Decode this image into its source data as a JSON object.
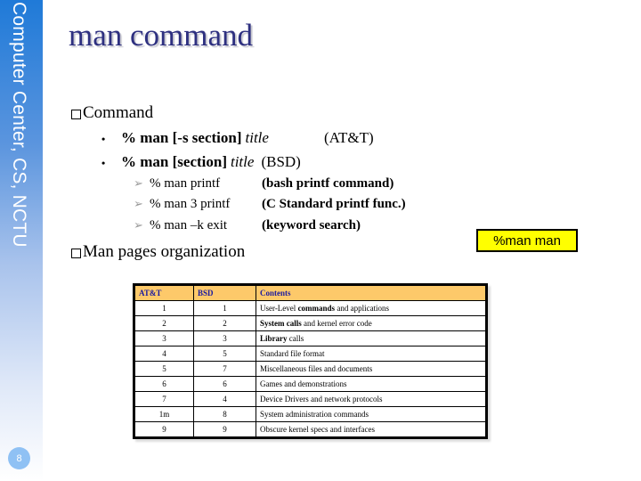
{
  "sidebar": {
    "title": "Computer Center, CS, NCTU",
    "page_number": "8"
  },
  "slide": {
    "title": "man command",
    "section1": {
      "heading": "Command",
      "bullets": [
        {
          "prefix": "% man [-s section]",
          "italic": "title",
          "note": "(AT&T)"
        },
        {
          "prefix": "% man [section]",
          "italic": "title",
          "note": "(BSD)"
        }
      ],
      "examples": [
        {
          "command": "% man printf",
          "note": "(bash printf command)"
        },
        {
          "command": "% man 3 printf",
          "note": "(C Standard printf func.)"
        },
        {
          "command": "% man –k exit",
          "note": "(keyword search)"
        }
      ]
    },
    "section2": {
      "heading": "Man pages organization"
    },
    "callout": "%man man",
    "table": {
      "headers": [
        "AT&T",
        "BSD",
        "Contents"
      ],
      "rows": [
        {
          "att": "1",
          "bsd": "1",
          "pre": "User-Level ",
          "bold": "commands",
          "post": " and applications"
        },
        {
          "att": "2",
          "bsd": "2",
          "pre": "",
          "bold": "System calls",
          "post": " and kernel error code"
        },
        {
          "att": "3",
          "bsd": "3",
          "pre": "",
          "bold": "Library",
          "post": " calls"
        },
        {
          "att": "4",
          "bsd": "5",
          "pre": "Standard file format",
          "bold": "",
          "post": ""
        },
        {
          "att": "5",
          "bsd": "7",
          "pre": "Miscellaneous files and documents",
          "bold": "",
          "post": ""
        },
        {
          "att": "6",
          "bsd": "6",
          "pre": "Games and demonstrations",
          "bold": "",
          "post": ""
        },
        {
          "att": "7",
          "bsd": "4",
          "pre": "Device Drivers and network protocols",
          "bold": "",
          "post": ""
        },
        {
          "att": "1m",
          "bsd": "8",
          "pre": "System administration commands",
          "bold": "",
          "post": ""
        },
        {
          "att": "9",
          "bsd": "9",
          "pre": "Obscure kernel specs and interfaces",
          "bold": "",
          "post": ""
        }
      ]
    }
  }
}
